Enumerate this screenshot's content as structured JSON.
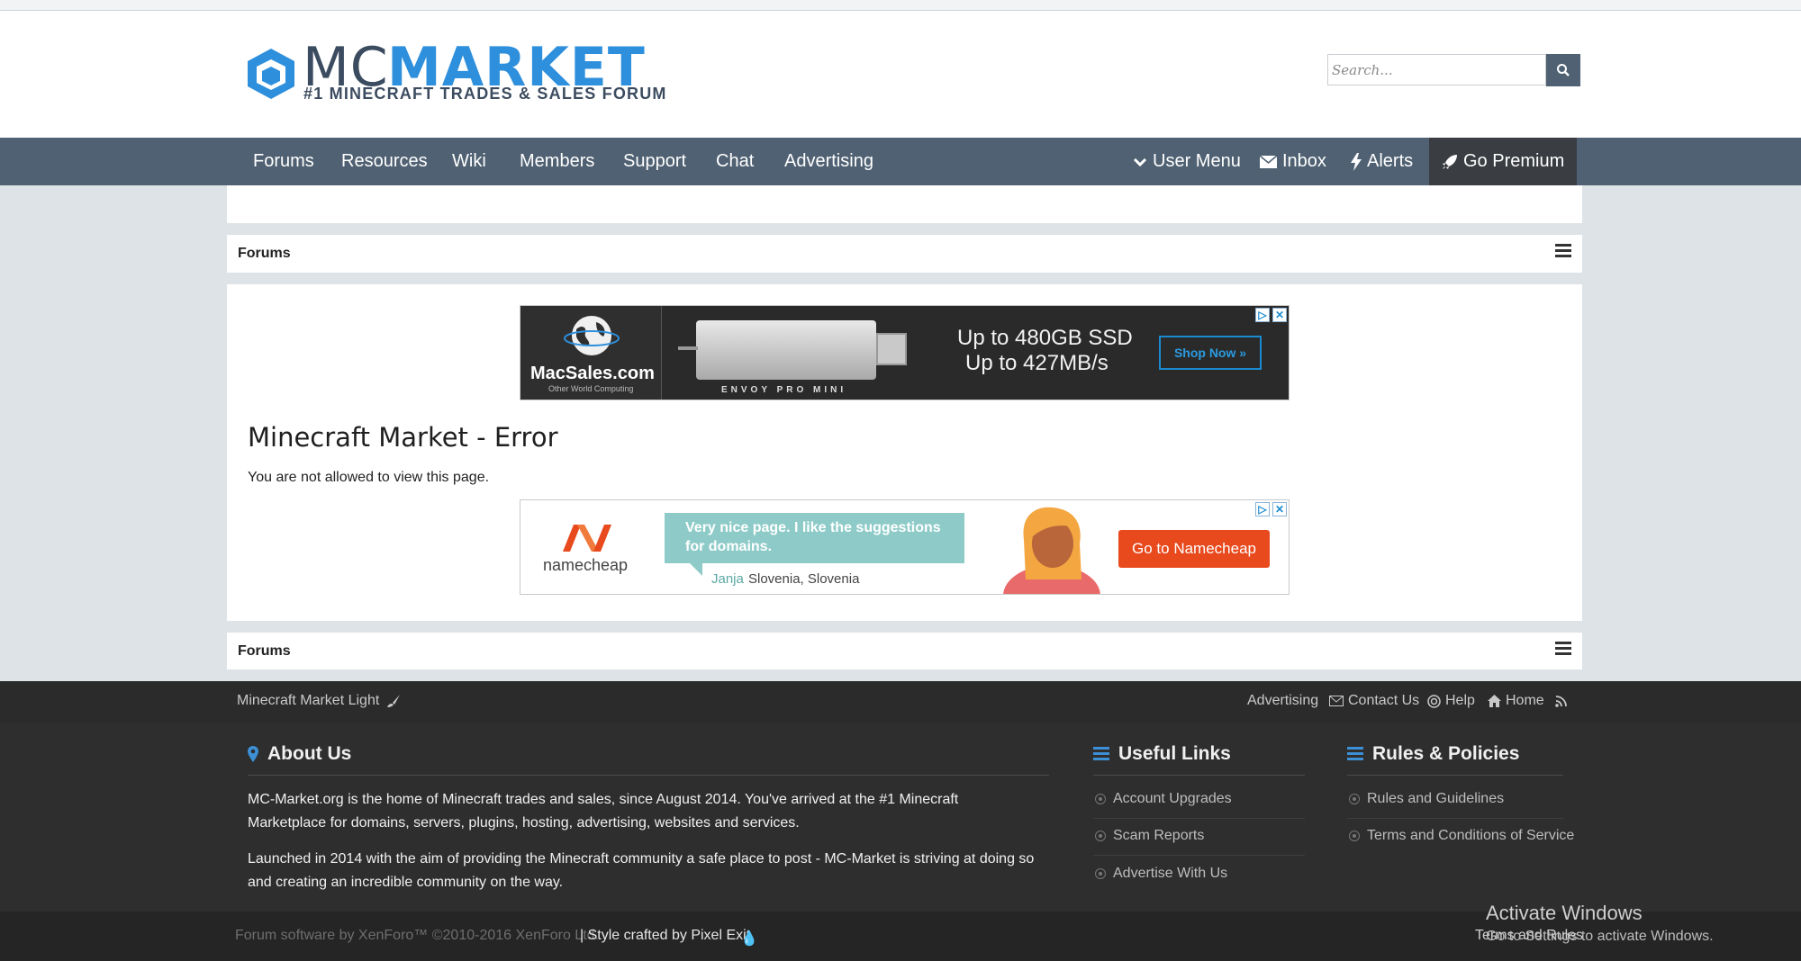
{
  "logo": {
    "mc": "MC",
    "market": "MARKET",
    "tagline": "#1 MINECRAFT TRADES & SALES FORUM"
  },
  "search": {
    "placeholder": "Search..."
  },
  "nav": {
    "items": [
      "Forums",
      "Resources",
      "Wiki",
      "Members",
      "Support",
      "Chat",
      "Advertising"
    ],
    "user_menu": "User Menu",
    "inbox": "Inbox",
    "alerts": "Alerts",
    "go_premium": "Go Premium"
  },
  "breadcrumb": {
    "top": "Forums",
    "bottom": "Forums"
  },
  "ad1": {
    "brand": "MacSales.com",
    "brand_sub": "Other World Computing",
    "product": "ENVOY PRO MINI",
    "line1": "Up to 480GB SSD",
    "line2": "Up to 427MB/s",
    "cta": "Shop Now »"
  },
  "error": {
    "title": "Minecraft Market - Error",
    "message": "You are not allowed to view this page."
  },
  "ad2": {
    "brand": "namecheap",
    "quote": "Very nice page. I like the suggestions for domains.",
    "author": "Janja",
    "location": "Slovenia, Slovenia",
    "cta": "Go to Namecheap"
  },
  "footer_bar": {
    "style": "Minecraft Market Light",
    "links": [
      "Advertising",
      "Contact Us",
      "Help",
      "Home"
    ]
  },
  "about": {
    "heading": "About Us",
    "p1": "MC-Market.org is the home of Minecraft trades and sales, since August 2014. You've arrived at the #1 Minecraft Marketplace for domains, servers, plugins, hosting, advertising, websites and services.",
    "p2": "Launched in 2014 with the aim of providing the Minecraft community a safe place to post - MC-Market is striving at doing so and creating an incredible community on the way."
  },
  "useful_links": {
    "heading": "Useful Links",
    "items": [
      "Account Upgrades",
      "Scam Reports",
      "Advertise With Us"
    ]
  },
  "rules": {
    "heading": "Rules & Policies",
    "items": [
      "Rules and Guidelines",
      "Terms and Conditions of Service"
    ]
  },
  "copyright": {
    "xenforo": "Forum software by XenForo™ ©2010-2016 XenForo Ltd.",
    "style": "| Style crafted by Pixel Exit",
    "terms": "Terms and Rules"
  },
  "windows": {
    "title": "Activate Windows",
    "sub": "Go to Settings to activate Windows."
  },
  "colors": {
    "nav": "#4f6172",
    "accent": "#2e8fdc",
    "footer": "#2e2e2e",
    "namecheap": "#e8491d"
  }
}
